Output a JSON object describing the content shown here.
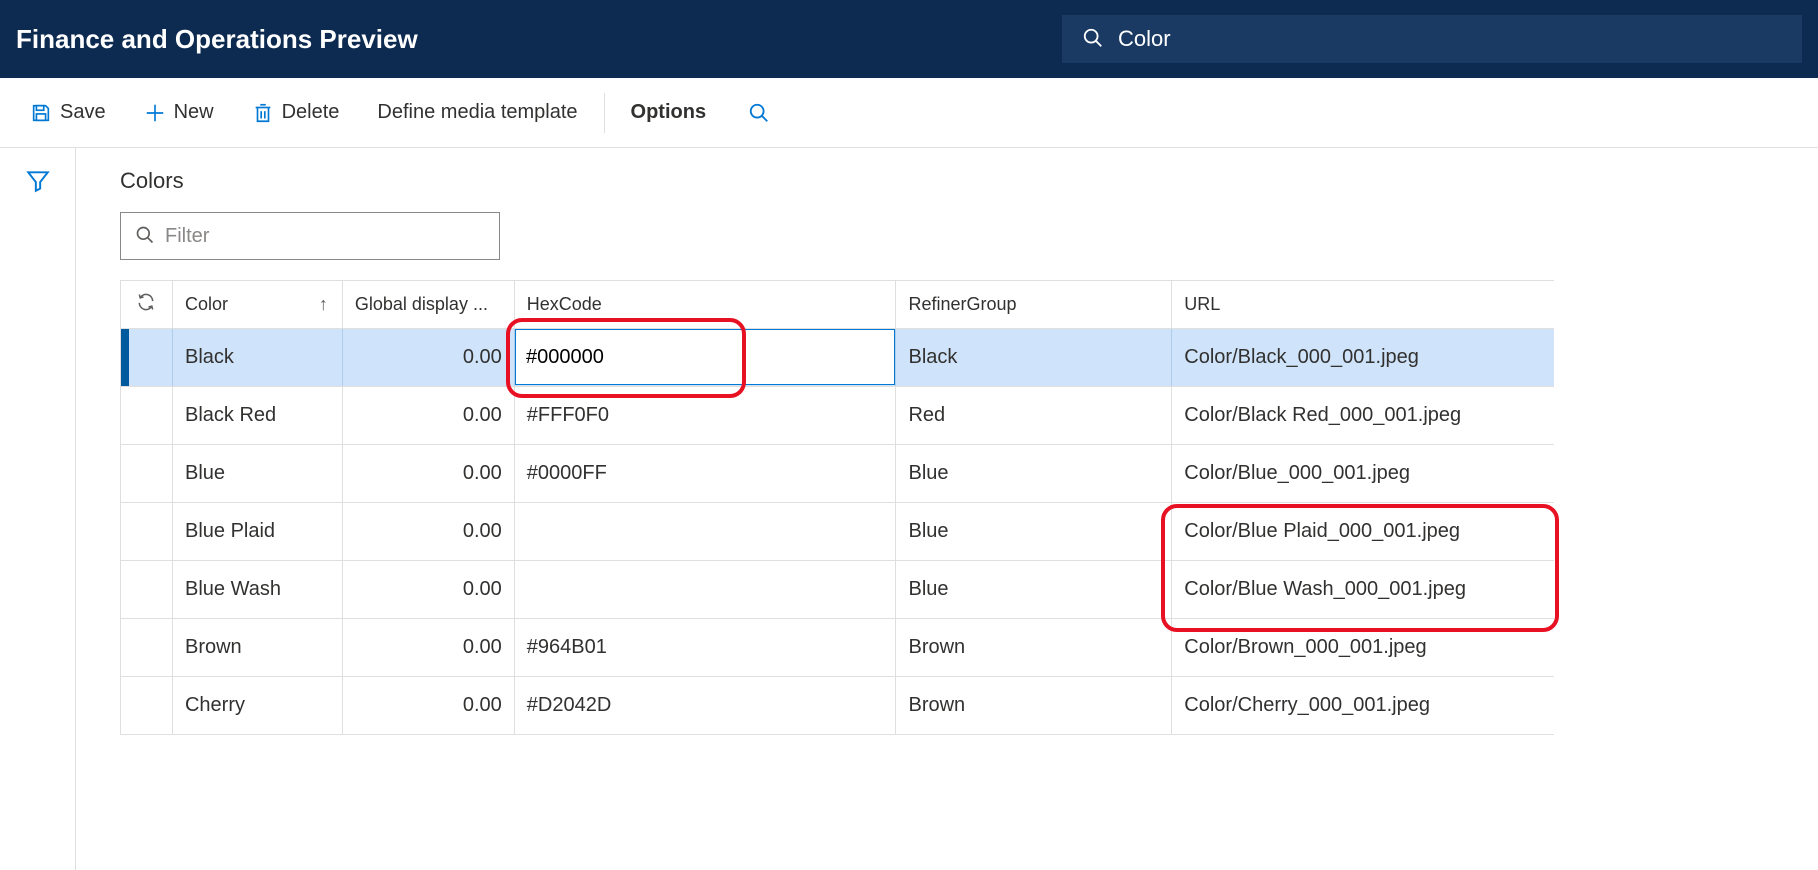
{
  "header": {
    "title": "Finance and Operations Preview",
    "search_value": "Color"
  },
  "toolbar": {
    "save": "Save",
    "new": "New",
    "delete": "Delete",
    "define_media": "Define media template",
    "options": "Options"
  },
  "main": {
    "section_title": "Colors",
    "filter_placeholder": "Filter"
  },
  "grid": {
    "columns": {
      "color": "Color",
      "global": "Global display ...",
      "hex": "HexCode",
      "refiner": "RefinerGroup",
      "url": "URL"
    },
    "sort_indicator": "↑",
    "rows": [
      {
        "color": "Black",
        "global": "0.00",
        "hex": "#000000",
        "refiner": "Black",
        "url": "Color/Black_000_001.jpeg",
        "selected": true,
        "editing_hex": true
      },
      {
        "color": "Black Red",
        "global": "0.00",
        "hex": "#FFF0F0",
        "refiner": "Red",
        "url": "Color/Black Red_000_001.jpeg",
        "selected": false
      },
      {
        "color": "Blue",
        "global": "0.00",
        "hex": "#0000FF",
        "refiner": "Blue",
        "url": "Color/Blue_000_001.jpeg",
        "selected": false
      },
      {
        "color": "Blue Plaid",
        "global": "0.00",
        "hex": "",
        "refiner": "Blue",
        "url": "Color/Blue Plaid_000_001.jpeg",
        "selected": false
      },
      {
        "color": "Blue Wash",
        "global": "0.00",
        "hex": "",
        "refiner": "Blue",
        "url": "Color/Blue Wash_000_001.jpeg",
        "selected": false
      },
      {
        "color": "Brown",
        "global": "0.00",
        "hex": "#964B01",
        "refiner": "Brown",
        "url": "Color/Brown_000_001.jpeg",
        "selected": false
      },
      {
        "color": "Cherry",
        "global": "0.00",
        "hex": "#D2042D",
        "refiner": "Brown",
        "url": "Color/Cherry_000_001.jpeg",
        "selected": false
      }
    ]
  }
}
